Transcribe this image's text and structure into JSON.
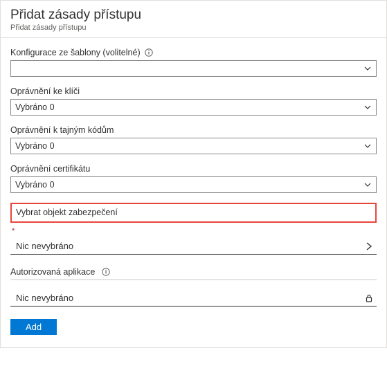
{
  "header": {
    "title": "Přidat zásady přístupu",
    "breadcrumb": "Přidat zásady přístupu"
  },
  "fields": {
    "template": {
      "label": "Konfigurace ze šablony (volitelné)",
      "value": ""
    },
    "key_perm": {
      "label": "Oprávnění ke klíči",
      "value": "Vybráno 0"
    },
    "secret_perm": {
      "label": "Oprávnění k tajným kódům",
      "value": "Vybráno 0"
    },
    "cert_perm": {
      "label": "Oprávnění certifikátu",
      "value": "Vybráno 0"
    }
  },
  "principal": {
    "select_label": "Vybrat objekt zabezpečení",
    "required_mark": "*",
    "none_selected": "Nic nevybráno"
  },
  "app": {
    "label": "Autorizovaná aplikace",
    "none_selected": "Nic nevybráno"
  },
  "actions": {
    "add": "Add"
  }
}
